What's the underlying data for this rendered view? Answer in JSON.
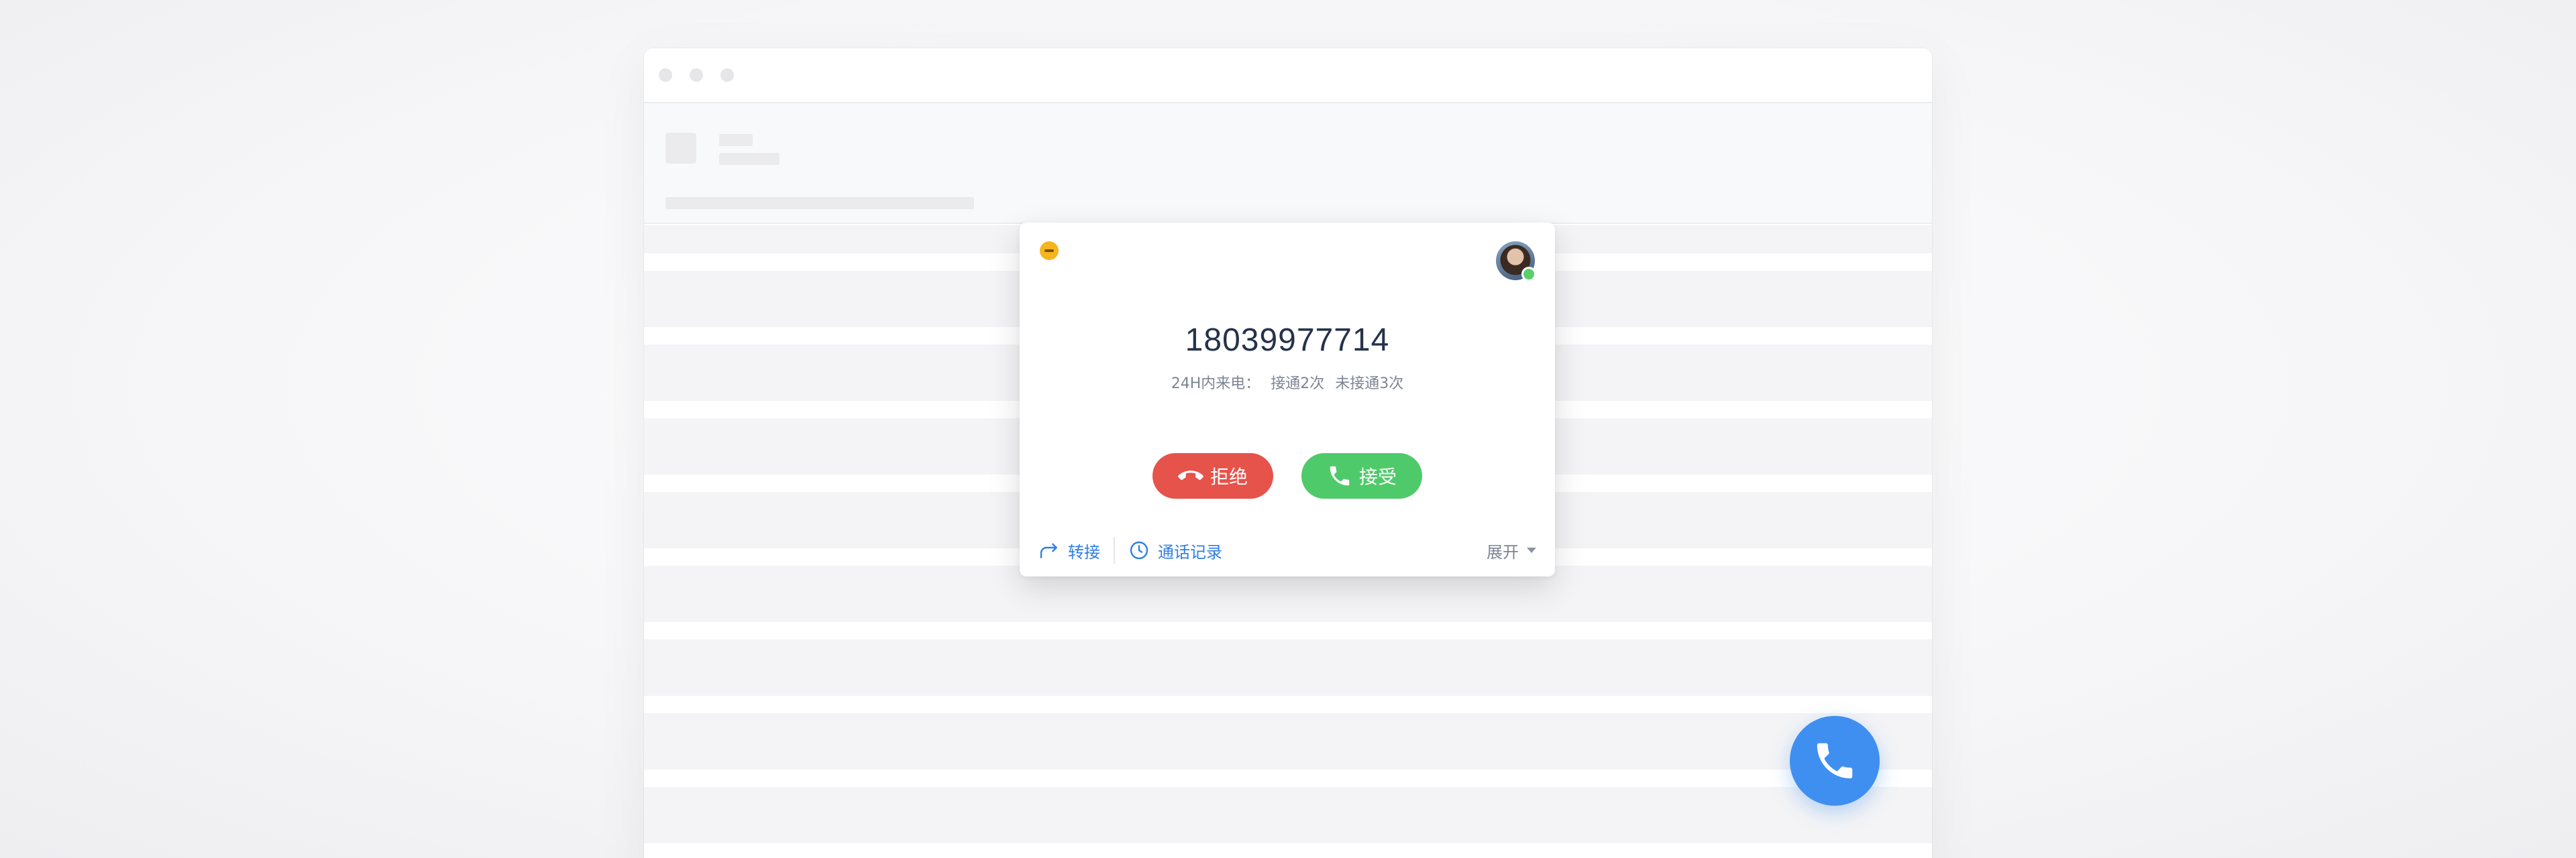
{
  "caller": {
    "phone_number": "18039977714",
    "stats_label": "24H内来电：",
    "connected": "接通2次",
    "missed": "未接通3次"
  },
  "actions": {
    "reject_label": "拒绝",
    "accept_label": "接受"
  },
  "footer": {
    "transfer_label": "转接",
    "history_label": "通话记录",
    "expand_label": "展开"
  },
  "icons": {
    "status": "busy-status-icon",
    "avatar": "user-avatar",
    "reject": "hangup-icon",
    "accept": "phone-icon",
    "transfer": "transfer-arrow-icon",
    "history": "clock-icon",
    "expand": "caret-down-icon",
    "fab": "phone-icon"
  },
  "colors": {
    "reject": "#e5534b",
    "accept": "#4fca6a",
    "link": "#2f7ee6",
    "status_busy": "#f6b51e",
    "online": "#5bd06a",
    "fab": "#3f8ff1"
  }
}
